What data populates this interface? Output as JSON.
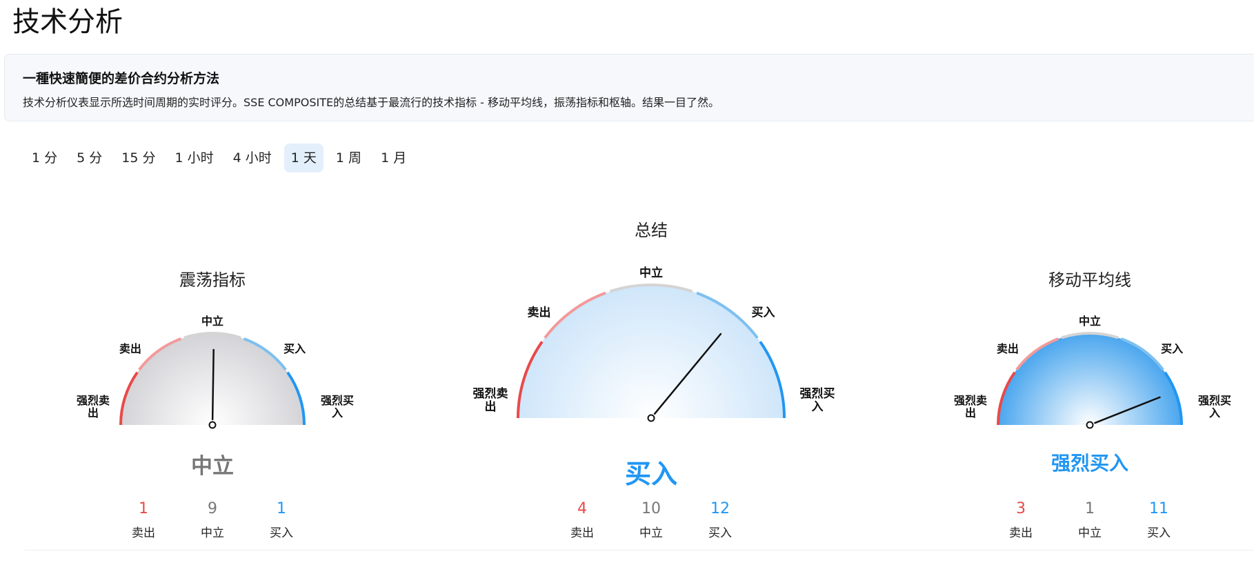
{
  "page": {
    "title": "技术分析"
  },
  "intro": {
    "heading": "一種快速簡便的差价合约分析方法",
    "text": "技术分析仪表显示所选时间周期的实时评分。SSE COMPOSITE的总结基于最流行的技术指标 - 移动平均线，振荡指标和枢轴。结果一目了然。"
  },
  "tabs": [
    {
      "label": "1 分",
      "active": false
    },
    {
      "label": "5 分",
      "active": false
    },
    {
      "label": "15 分",
      "active": false
    },
    {
      "label": "1 小时",
      "active": false
    },
    {
      "label": "4 小时",
      "active": false
    },
    {
      "label": "1 天",
      "active": true
    },
    {
      "label": "1 周",
      "active": false
    },
    {
      "label": "1 月",
      "active": false
    }
  ],
  "gauges": {
    "oscillators": {
      "title": "震荡指标",
      "verdict": "中立",
      "needle_value": 0.505,
      "scale": {
        "strong_sell": "强烈卖出",
        "sell": "卖出",
        "neutral": "中立",
        "buy": "买入",
        "strong_buy": "强烈买入"
      },
      "counts": [
        {
          "value": "1",
          "label": "卖出"
        },
        {
          "value": "9",
          "label": "中立"
        },
        {
          "value": "1",
          "label": "买入"
        }
      ]
    },
    "summary": {
      "title": "总结",
      "verdict": "买入",
      "needle_value": 0.72,
      "scale": {
        "strong_sell": "强烈卖出",
        "sell": "卖出",
        "neutral": "中立",
        "buy": "买入",
        "strong_buy": "强烈买入"
      },
      "counts": [
        {
          "value": "4",
          "label": "卖出"
        },
        {
          "value": "10",
          "label": "中立"
        },
        {
          "value": "12",
          "label": "买入"
        }
      ]
    },
    "moving_averages": {
      "title": "移动平均线",
      "verdict": "强烈买入",
      "needle_value": 0.88,
      "scale": {
        "strong_sell": "强烈卖出",
        "sell": "卖出",
        "neutral": "中立",
        "buy": "买入",
        "strong_buy": "强烈买入"
      },
      "counts": [
        {
          "value": "3",
          "label": "卖出"
        },
        {
          "value": "1",
          "label": "中立"
        },
        {
          "value": "11",
          "label": "买入"
        }
      ]
    }
  },
  "colors": {
    "strong_sell": "#e84a4a",
    "sell": "#f19a9a",
    "neutral": "#d4d4d4",
    "buy": "#7ec0f0",
    "strong_buy": "#2196f3"
  }
}
